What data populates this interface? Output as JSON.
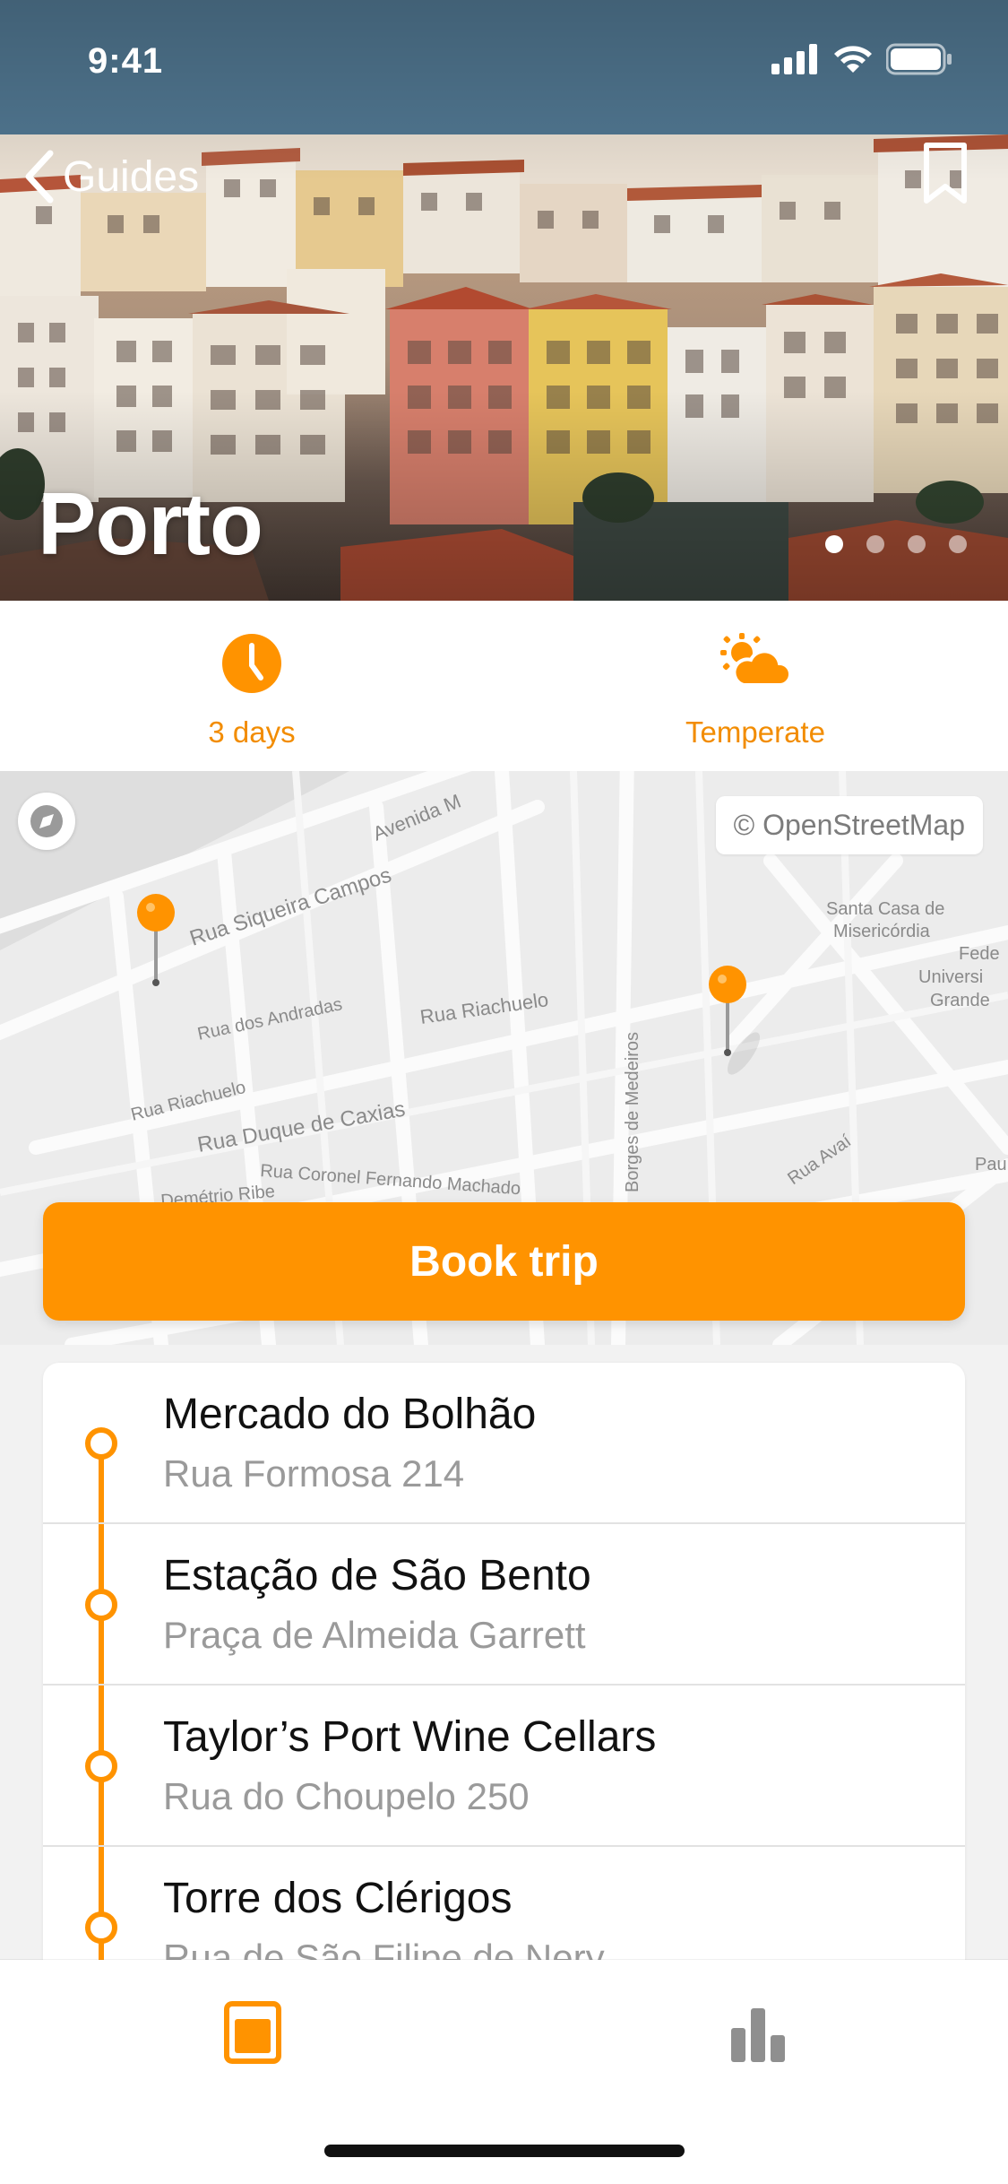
{
  "status_bar": {
    "time": "9:41"
  },
  "nav": {
    "back_label": "Guides"
  },
  "hero": {
    "title": "Porto",
    "pages": 4,
    "active_page": 0
  },
  "info": [
    {
      "icon": "clock-icon",
      "label": "3 days"
    },
    {
      "icon": "sun-cloud-icon",
      "label": "Temperate"
    }
  ],
  "map": {
    "attribution": "© OpenStreetMap",
    "street_labels": [
      "Avenida M",
      "Rua Siqueira Campos",
      "Rua dos Andradas",
      "Rua Riachuelo",
      "Rua Riachuelo",
      "Rua Duque de Caxias",
      "Rua Coronel Fernando Machado",
      "Borges de Medeiros",
      "Santa Casa de",
      "Misericórdia",
      "Rua Avaí",
      "Fede",
      "Universi",
      "Grande",
      "Paulo",
      "Demétrio Ribe"
    ]
  },
  "actions": {
    "book_label": "Book trip"
  },
  "itinerary": [
    {
      "name": "Mercado do Bolhão",
      "address": "Rua Formosa 214"
    },
    {
      "name": "Estação de São Bento",
      "address": "Praça de Almeida Garrett"
    },
    {
      "name": "Taylor’s Port Wine Cellars",
      "address": "Rua do Choupelo 250"
    },
    {
      "name": "Torre dos Clérigos",
      "address": "Rua de São Filipe de Nery"
    }
  ],
  "tabbar": [
    {
      "icon": "guide-book-icon",
      "active": true
    },
    {
      "icon": "stats-icon",
      "active": false
    }
  ],
  "colors": {
    "accent": "#ff9300",
    "text_accent": "#f28c00",
    "muted": "#9a9a9a"
  }
}
